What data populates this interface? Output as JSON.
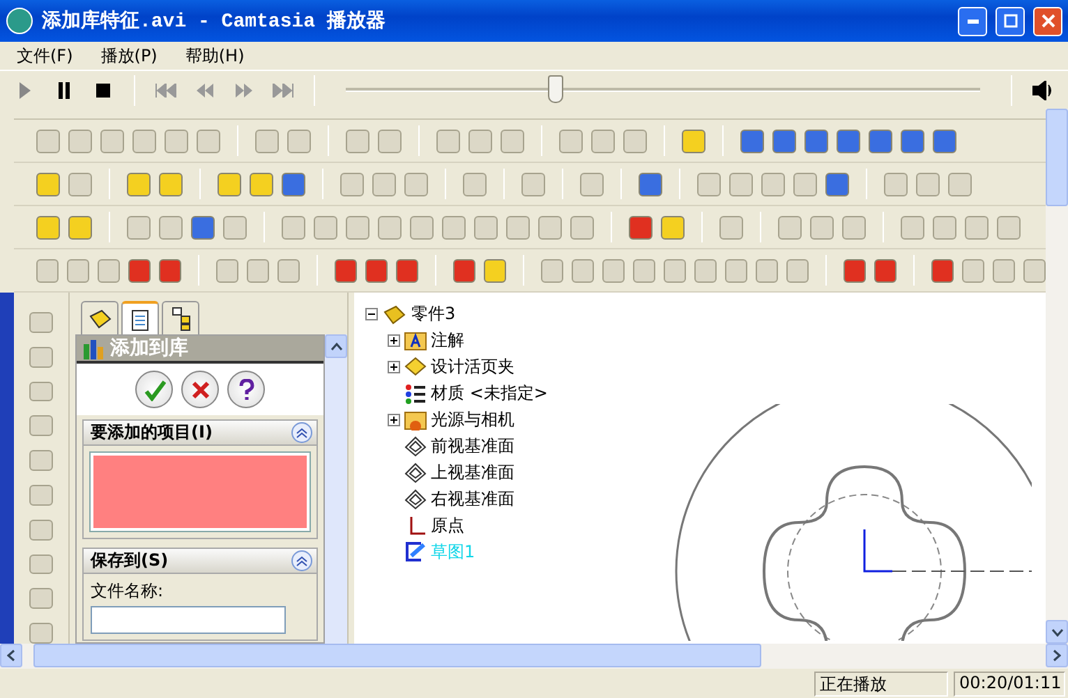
{
  "window": {
    "title": "添加库特征.avi - Camtasia 播放器"
  },
  "menu": [
    "文件(F)",
    "播放(P)",
    "帮助(H)"
  ],
  "player": {
    "seek": {
      "level": 0.33
    }
  },
  "video": {
    "property_manager": {
      "tabs": [
        {
          "kind": "part",
          "selected": false
        },
        {
          "kind": "property",
          "selected": true
        },
        {
          "kind": "config",
          "selected": false
        }
      ],
      "title": "添加到库",
      "sections": [
        {
          "kind": "items",
          "title": "要添加的项目(I)"
        },
        {
          "kind": "save",
          "title": "保存到(S)",
          "field_label": "文件名称:"
        }
      ]
    },
    "tree": {
      "root": "零件3",
      "children": [
        {
          "label": "注解",
          "kind": "annotation",
          "expandable": true,
          "selected": false
        },
        {
          "label": "设计活页夹",
          "kind": "binder",
          "expandable": true,
          "selected": false
        },
        {
          "label": "材质 <未指定>",
          "kind": "material",
          "expandable": false,
          "selected": false
        },
        {
          "label": "光源与相机",
          "kind": "lights",
          "expandable": true,
          "selected": false
        },
        {
          "label": "前视基准面",
          "kind": "plane",
          "expandable": false,
          "selected": false
        },
        {
          "label": "上视基准面",
          "kind": "plane",
          "expandable": false,
          "selected": false
        },
        {
          "label": "右视基准面",
          "kind": "plane",
          "expandable": false,
          "selected": false
        },
        {
          "label": "原点",
          "kind": "origin",
          "expandable": false,
          "selected": false
        },
        {
          "label": "草图1",
          "kind": "sketch",
          "expandable": false,
          "selected": true
        }
      ]
    }
  },
  "status": {
    "state": "正在播放",
    "time": "00:20/01:11"
  }
}
